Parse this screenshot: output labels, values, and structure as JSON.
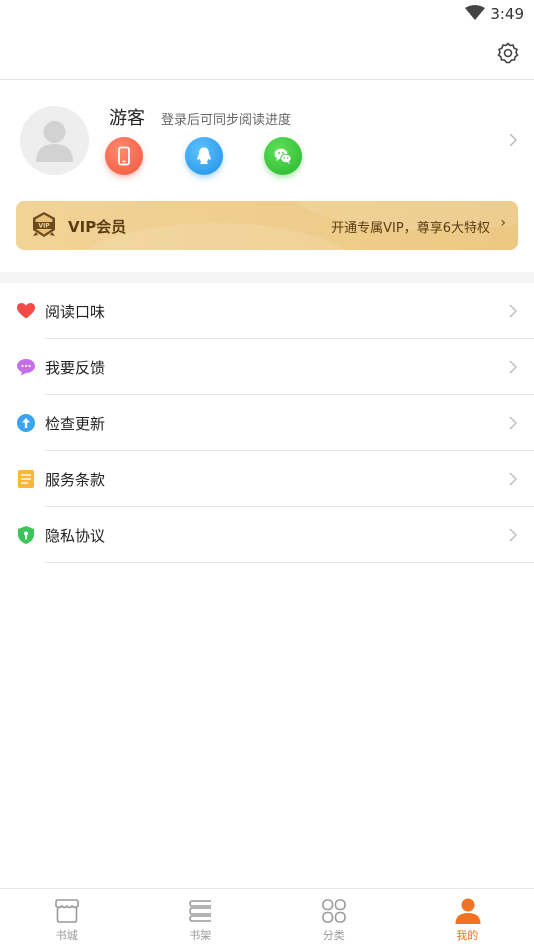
{
  "status_bar": {
    "time": "3:49"
  },
  "profile": {
    "username": "游客",
    "login_tip": "登录后可同步阅读进度",
    "login_methods": [
      "phone",
      "qq",
      "wechat"
    ]
  },
  "vip": {
    "title": "VIP会员",
    "description": "开通专属VIP，尊享6大特权",
    "arrow": "›",
    "badge_text": "VIP"
  },
  "menu": {
    "items": [
      {
        "label": "阅读口味",
        "icon": "heart-icon"
      },
      {
        "label": "我要反馈",
        "icon": "chat-bubble-icon"
      },
      {
        "label": "检查更新",
        "icon": "upload-arrow-icon"
      },
      {
        "label": "服务条款",
        "icon": "document-icon"
      },
      {
        "label": "隐私协议",
        "icon": "shield-icon"
      }
    ]
  },
  "tabs": [
    {
      "label": "书城",
      "icon": "store-icon",
      "active": false
    },
    {
      "label": "书架",
      "icon": "bookshelf-icon",
      "active": false
    },
    {
      "label": "分类",
      "icon": "category-icon",
      "active": false
    },
    {
      "label": "我的",
      "icon": "person-icon",
      "active": true
    }
  ],
  "colors": {
    "accent": "#f07222",
    "vip_gold": "#f2d397",
    "vip_text": "#5a3d12"
  }
}
